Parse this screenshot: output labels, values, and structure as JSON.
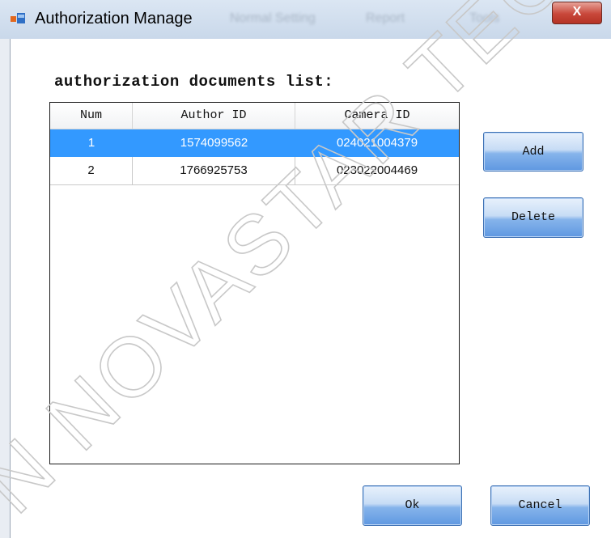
{
  "window": {
    "title": "Authorization Manage",
    "close_glyph": "X",
    "background_menu": [
      "Normal Setting",
      "Report",
      "Tools"
    ]
  },
  "list": {
    "label": "authorization documents list:",
    "columns": [
      "Num",
      "Author ID",
      "Camera ID"
    ],
    "rows": [
      {
        "num": "1",
        "author_id": "1574099562",
        "camera_id": "024021004379",
        "selected": true
      },
      {
        "num": "2",
        "author_id": "1766925753",
        "camera_id": "023022004469",
        "selected": false
      }
    ]
  },
  "buttons": {
    "add": "Add",
    "delete": "Delete",
    "ok": "Ok",
    "cancel": "Cancel"
  },
  "watermark": {
    "text": "N NOVASTAR TECH"
  },
  "colors": {
    "selection": "#3399ff",
    "button_blue": "#5f98e1",
    "close_red": "#c8473a"
  }
}
